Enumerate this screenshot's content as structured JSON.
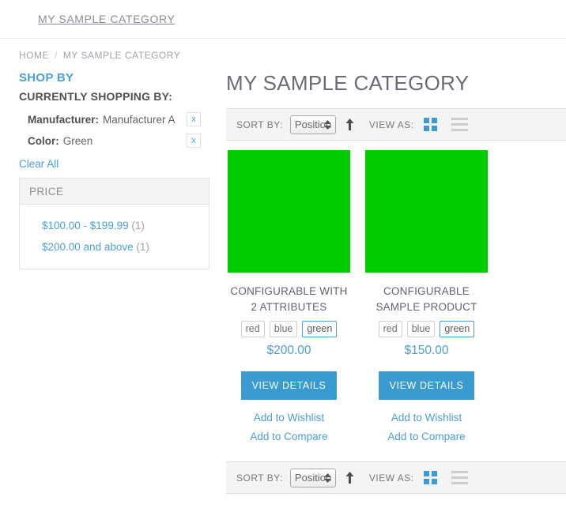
{
  "topnav": {
    "items": [
      {
        "label": "MY SAMPLE CATEGORY"
      }
    ]
  },
  "breadcrumbs": {
    "home": "HOME",
    "separator": "/",
    "current": "MY SAMPLE CATEGORY"
  },
  "sidebar": {
    "shop_by": "SHOP BY",
    "currently_shopping_by": "CURRENTLY SHOPPING BY:",
    "active_filters": [
      {
        "label": "Manufacturer:",
        "value": "Manufacturer A",
        "remove": "x"
      },
      {
        "label": "Color:",
        "value": "Green",
        "remove": "x"
      }
    ],
    "clear_all": "Clear All",
    "price_filter": {
      "title": "PRICE",
      "options": [
        {
          "label": "$100.00 - $199.99",
          "count": "(1)"
        },
        {
          "label": "$200.00 and above",
          "count": "(1)"
        }
      ]
    }
  },
  "main": {
    "page_title": "MY SAMPLE CATEGORY",
    "toolbar": {
      "sort_by_label": "SORT BY:",
      "sort_value": "Position",
      "sort_options": [
        "Position"
      ],
      "sort_direction": "ascending",
      "view_as_label": "VIEW AS:",
      "active_view": "grid"
    },
    "products": [
      {
        "name": "CONFIGURABLE WITH 2 ATTRIBUTES",
        "image_color": "#00cc00",
        "swatches": [
          {
            "label": "red",
            "selected": false
          },
          {
            "label": "blue",
            "selected": false
          },
          {
            "label": "green",
            "selected": true
          }
        ],
        "price": "$200.00",
        "details_button": "VIEW DETAILS",
        "links": [
          "Add to Wishlist",
          "Add to Compare"
        ]
      },
      {
        "name": "CONFIGURABLE SAMPLE PRODUCT",
        "image_color": "#00cc00",
        "swatches": [
          {
            "label": "red",
            "selected": false
          },
          {
            "label": "blue",
            "selected": false
          },
          {
            "label": "green",
            "selected": true
          }
        ],
        "price": "$150.00",
        "details_button": "VIEW DETAILS",
        "links": [
          "Add to Wishlist",
          "Add to Compare"
        ]
      }
    ]
  },
  "colors": {
    "accent_blue": "#4a9fd5",
    "button_blue": "#3a9bd0",
    "product_green": "#00cc00",
    "text_gray": "#636370"
  }
}
